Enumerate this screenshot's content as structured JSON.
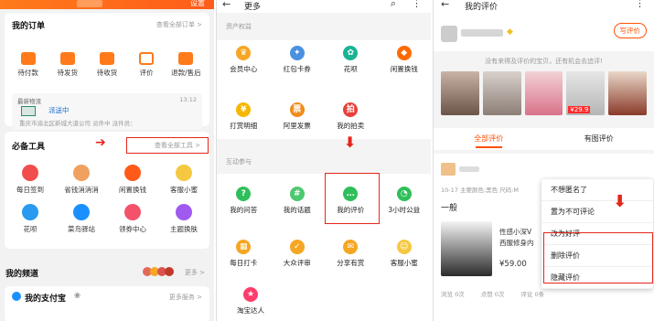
{
  "panel1": {
    "settings_label": "设置",
    "my_orders": {
      "title": "我的订单",
      "view_all": "查看全部订单 >",
      "items": [
        {
          "label": "待付款",
          "icon": "wallet-icon"
        },
        {
          "label": "待发货",
          "icon": "package-icon"
        },
        {
          "label": "待收货",
          "icon": "truck-icon"
        },
        {
          "label": "评价",
          "icon": "comment-icon"
        },
        {
          "label": "退款/售后",
          "icon": "refund-icon"
        }
      ]
    },
    "logistics": {
      "label": "最新物流",
      "time": "13:12",
      "status": "派送中",
      "address": "重庆市渝北区新城大道公司 派件中 派件员："
    },
    "tools": {
      "title": "必备工具",
      "view_all": "查看全部工具 >",
      "items": [
        {
          "label": "每日签到",
          "icon": "calendar-icon",
          "color": "#f24d4d"
        },
        {
          "label": "省钱消消消",
          "icon": "game-icon",
          "color": "#f0a060"
        },
        {
          "label": "闲置换钱",
          "icon": "flame-icon",
          "color": "#ff5a1a"
        },
        {
          "label": "客服小蜜",
          "icon": "bot-icon",
          "color": "#f5c842"
        },
        {
          "label": "花呗",
          "icon": "huabei-icon",
          "color": "#2a9af0"
        },
        {
          "label": "菜鸟驿站",
          "icon": "station-icon",
          "color": "#1a90ff"
        },
        {
          "label": "领券中心",
          "icon": "coupon-icon",
          "color": "#f2536b"
        },
        {
          "label": "主题换肤",
          "icon": "theme-icon",
          "color": "#a05af0"
        }
      ]
    },
    "channel": {
      "title": "我的频道",
      "more": "更多 >"
    },
    "alipay": {
      "title": "我的支付宝",
      "more": "更多服务 >"
    }
  },
  "panel2": {
    "title": "更多",
    "section_assets": "资产权益",
    "assets": [
      {
        "label": "会员中心",
        "icon": "crown-icon",
        "color": "#f5a623"
      },
      {
        "label": "红包卡券",
        "icon": "redpacket-icon",
        "color": "#4a90e2"
      },
      {
        "label": "花呗",
        "icon": "huabei-icon",
        "color": "#1ab394"
      },
      {
        "label": "闲置换钱",
        "icon": "flame-icon",
        "color": "#ff6a00"
      }
    ],
    "assets2": [
      {
        "label": "打赏明细",
        "icon": "coin-icon",
        "color": "#f5b800"
      },
      {
        "label": "阿里发票",
        "icon": "invoice-icon",
        "color": "#f08c1a"
      },
      {
        "label": "我的拍卖",
        "icon": "auction-icon",
        "color": "#e8413c"
      }
    ],
    "section_interact": "互动参与",
    "interact": [
      {
        "label": "我的问答",
        "icon": "question-icon",
        "color": "#2fbf5a"
      },
      {
        "label": "我的话题",
        "icon": "hashtag-icon",
        "color": "#4cc870"
      },
      {
        "label": "我的评价",
        "icon": "review-icon",
        "color": "#2fbf5a"
      },
      {
        "label": "3小时公益",
        "icon": "charity-icon",
        "color": "#2fbf5a"
      }
    ],
    "interact2": [
      {
        "label": "每日打卡",
        "icon": "calendar-icon",
        "color": "#f5a623"
      },
      {
        "label": "大众评审",
        "icon": "judge-icon",
        "color": "#f5a623"
      },
      {
        "label": "分享有赏",
        "icon": "share-icon",
        "color": "#f5a623"
      },
      {
        "label": "客服小蜜",
        "icon": "bot-icon",
        "color": "#f5c842"
      }
    ],
    "interact3": [
      {
        "label": "淘宝达人",
        "icon": "star-icon",
        "color": "#ff3b6b"
      }
    ]
  },
  "panel3": {
    "title": "我的评价",
    "write_button": "写评价",
    "prompt": "没有来得及评价的宝贝，还有机会去追评!",
    "price_tag": "¥29.9",
    "tabs": [
      "全部评价",
      "有图评价"
    ],
    "review": {
      "meta": "10-17  主要颜色:黑色 尺码:M",
      "text": "一般",
      "product_name": "性感小深V",
      "product_desc": "西服修身内",
      "product_price": "¥59.00",
      "stats": [
        "浏览 0次",
        "点赞 0次",
        "评论 0条"
      ]
    },
    "menu": [
      "不想匿名了",
      "置为不可评论",
      "改为好评",
      "删除评价",
      "隐藏评价"
    ],
    "colors": {
      "accent": "#ff5000",
      "annotation_red": "#e4261a"
    }
  }
}
